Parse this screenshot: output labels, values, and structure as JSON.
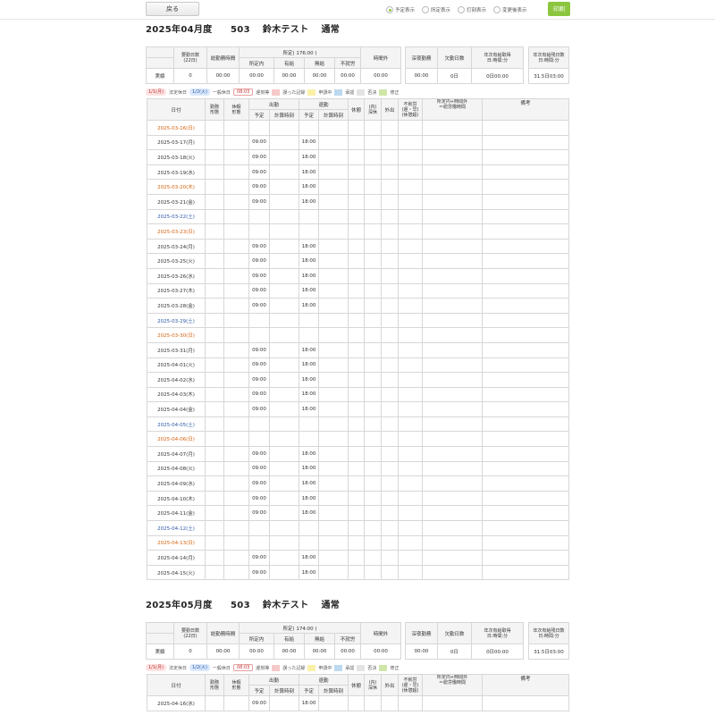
{
  "toolbar": {
    "back_label": "戻る",
    "print_label": "印刷",
    "view_options": [
      {
        "label": "予定表示",
        "selected": true
      },
      {
        "label": "所定表示",
        "selected": false
      },
      {
        "label": "打刻表示",
        "selected": false
      },
      {
        "label": "変更後表示",
        "selected": false
      }
    ]
  },
  "colors": {
    "accent": "#8cc63f",
    "sunday_text": "#d4600a",
    "saturday_text": "#2a58a8"
  },
  "summary_headers": {
    "work_days": "要勤日数",
    "work_days_sub": "(22日)",
    "total_hours": "総勤務時間",
    "fixed": "所定( 176:00 )",
    "within_fixed": "所定内",
    "paid": "有給",
    "unpaid": "無給",
    "shortfall": "不就労",
    "overtime": "時間外",
    "late_night": "深夜勤務",
    "absent": "欠勤日数",
    "annual_taken": "年次有給取得",
    "annual_taken_sub": "日:時間:分",
    "annual_remaining": "年次有給残日数",
    "annual_remaining_sub": "日:時間:分",
    "row_label": "実績"
  },
  "legend": {
    "holiday_chip": "1/1(月)",
    "holiday_text": "法定休日",
    "saturday_chip": "1/2(火)",
    "saturday_text": "一般休日",
    "time_chip": "08:03",
    "time_text": "遅刻等",
    "items": [
      {
        "color": "#f6c9c9",
        "label": "誤った記録"
      },
      {
        "color": "#fbf0a8",
        "label": "申請中"
      },
      {
        "color": "#bcd9ef",
        "label": "承認"
      },
      {
        "color": "#e3e3e3",
        "label": "否決"
      },
      {
        "color": "#cfe6a8",
        "label": "修正"
      }
    ]
  },
  "table_headers": {
    "date": "日付",
    "work_type": "勤務\n形態",
    "leave_type": "休暇\n形態",
    "clock_in": "出勤",
    "clock_out": "退勤",
    "scheduled": "予定",
    "calc_time": "計算時刻",
    "break": "休憩",
    "inner_break": "(内)\n深休",
    "going_out": "外出",
    "shortfall": "不就労\n(遅・早)\n(休憩超)",
    "legal": "所定内+時間外\n＝総労働時間",
    "remarks": "備考"
  },
  "months": [
    {
      "title": "2025年04月度　　503　 鈴木テスト　 通常",
      "summary": {
        "fixed": "所定( 176:00 )",
        "values": [
          "0",
          "00:00",
          "00:00",
          "00:00",
          "00:00",
          "00:00",
          "00:00",
          "00:00",
          "0日",
          "0日00:00",
          "31.5日03:00"
        ]
      },
      "rows": [
        {
          "date": "2025-03-16(日)",
          "kind": "sun",
          "in": "",
          "out": ""
        },
        {
          "date": "2025-03-17(月)",
          "kind": "",
          "in": "09:00",
          "out": "18:00"
        },
        {
          "date": "2025-03-18(火)",
          "kind": "",
          "in": "09:00",
          "out": "18:00"
        },
        {
          "date": "2025-03-19(水)",
          "kind": "",
          "in": "09:00",
          "out": "18:00"
        },
        {
          "date": "2025-03-20(木)",
          "kind": "sun",
          "in": "09:00",
          "out": "18:00"
        },
        {
          "date": "2025-03-21(金)",
          "kind": "",
          "in": "09:00",
          "out": "18:00"
        },
        {
          "date": "2025-03-22(土)",
          "kind": "sat",
          "in": "",
          "out": ""
        },
        {
          "date": "2025-03-23(日)",
          "kind": "sun",
          "in": "",
          "out": ""
        },
        {
          "date": "2025-03-24(月)",
          "kind": "",
          "in": "09:00",
          "out": "18:00"
        },
        {
          "date": "2025-03-25(火)",
          "kind": "",
          "in": "09:00",
          "out": "18:00"
        },
        {
          "date": "2025-03-26(水)",
          "kind": "",
          "in": "09:00",
          "out": "18:00"
        },
        {
          "date": "2025-03-27(木)",
          "kind": "",
          "in": "09:00",
          "out": "18:00"
        },
        {
          "date": "2025-03-28(金)",
          "kind": "",
          "in": "09:00",
          "out": "18:00"
        },
        {
          "date": "2025-03-29(土)",
          "kind": "sat",
          "in": "",
          "out": ""
        },
        {
          "date": "2025-03-30(日)",
          "kind": "sun",
          "in": "",
          "out": ""
        },
        {
          "date": "2025-03-31(月)",
          "kind": "",
          "in": "09:00",
          "out": "18:00"
        },
        {
          "date": "2025-04-01(火)",
          "kind": "",
          "in": "09:00",
          "out": "18:00"
        },
        {
          "date": "2025-04-02(水)",
          "kind": "",
          "in": "09:00",
          "out": "18:00"
        },
        {
          "date": "2025-04-03(木)",
          "kind": "",
          "in": "09:00",
          "out": "18:00"
        },
        {
          "date": "2025-04-04(金)",
          "kind": "",
          "in": "09:00",
          "out": "18:00"
        },
        {
          "date": "2025-04-05(土)",
          "kind": "sat",
          "in": "",
          "out": ""
        },
        {
          "date": "2025-04-06(日)",
          "kind": "sun",
          "in": "",
          "out": ""
        },
        {
          "date": "2025-04-07(月)",
          "kind": "",
          "in": "09:00",
          "out": "18:00"
        },
        {
          "date": "2025-04-08(火)",
          "kind": "",
          "in": "09:00",
          "out": "18:00"
        },
        {
          "date": "2025-04-09(水)",
          "kind": "",
          "in": "09:00",
          "out": "18:00"
        },
        {
          "date": "2025-04-10(木)",
          "kind": "",
          "in": "09:00",
          "out": "18:00"
        },
        {
          "date": "2025-04-11(金)",
          "kind": "",
          "in": "09:00",
          "out": "18:00"
        },
        {
          "date": "2025-04-12(土)",
          "kind": "sat",
          "in": "",
          "out": ""
        },
        {
          "date": "2025-04-13(日)",
          "kind": "sun",
          "in": "",
          "out": ""
        },
        {
          "date": "2025-04-14(月)",
          "kind": "",
          "in": "09:00",
          "out": "18:00"
        },
        {
          "date": "2025-04-15(火)",
          "kind": "",
          "in": "09:00",
          "out": "18:00"
        }
      ]
    },
    {
      "title": "2025年05月度　　503　 鈴木テスト　 通常",
      "summary": {
        "fixed": "所定( 174:00 )",
        "values": [
          "0",
          "00:00",
          "00:00",
          "00:00",
          "00:00",
          "00:00",
          "00:00",
          "00:00",
          "0日",
          "0日00:00",
          "31.5日03:00"
        ]
      },
      "rows": [
        {
          "date": "2025-04-16(水)",
          "kind": "",
          "in": "09:00",
          "out": "18:00"
        }
      ]
    }
  ]
}
